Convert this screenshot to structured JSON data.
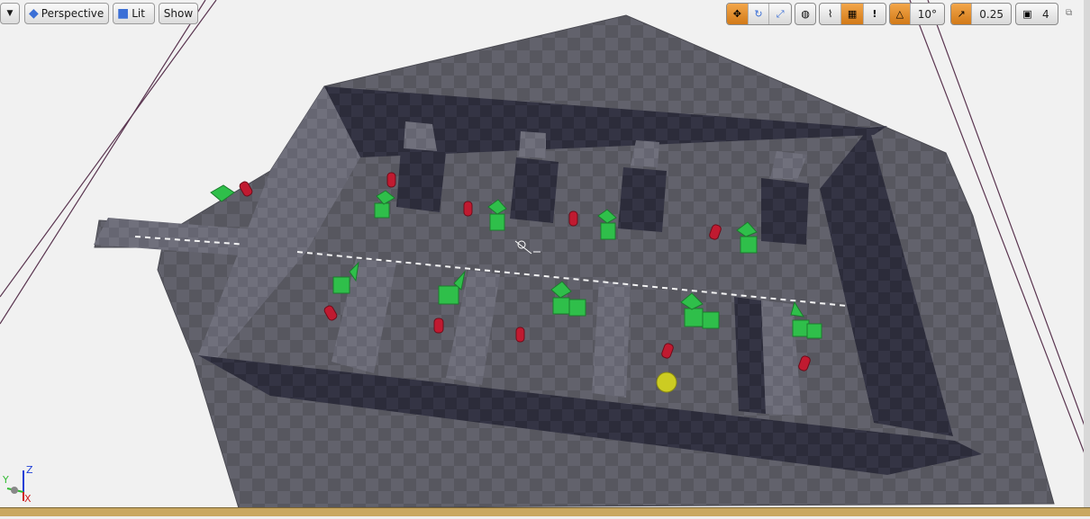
{
  "toolbar": {
    "dropdown_label": "",
    "perspective_label": "Perspective",
    "lit_label": "Lit",
    "show_label": "Show",
    "rotation_snap_value": "10°",
    "scale_snap_value": "0.25",
    "camera_speed_value": "4"
  },
  "axis": {
    "z_label": "Z",
    "y_label": "Y",
    "x_label": "X"
  },
  "colors": {
    "accent": "#e8951c",
    "floor": "#5f5f68",
    "wall_dark": "#2d2d3a",
    "cube": "#2fbf4a",
    "cylinder": "#c01a30",
    "sphere": "#cccc22"
  }
}
